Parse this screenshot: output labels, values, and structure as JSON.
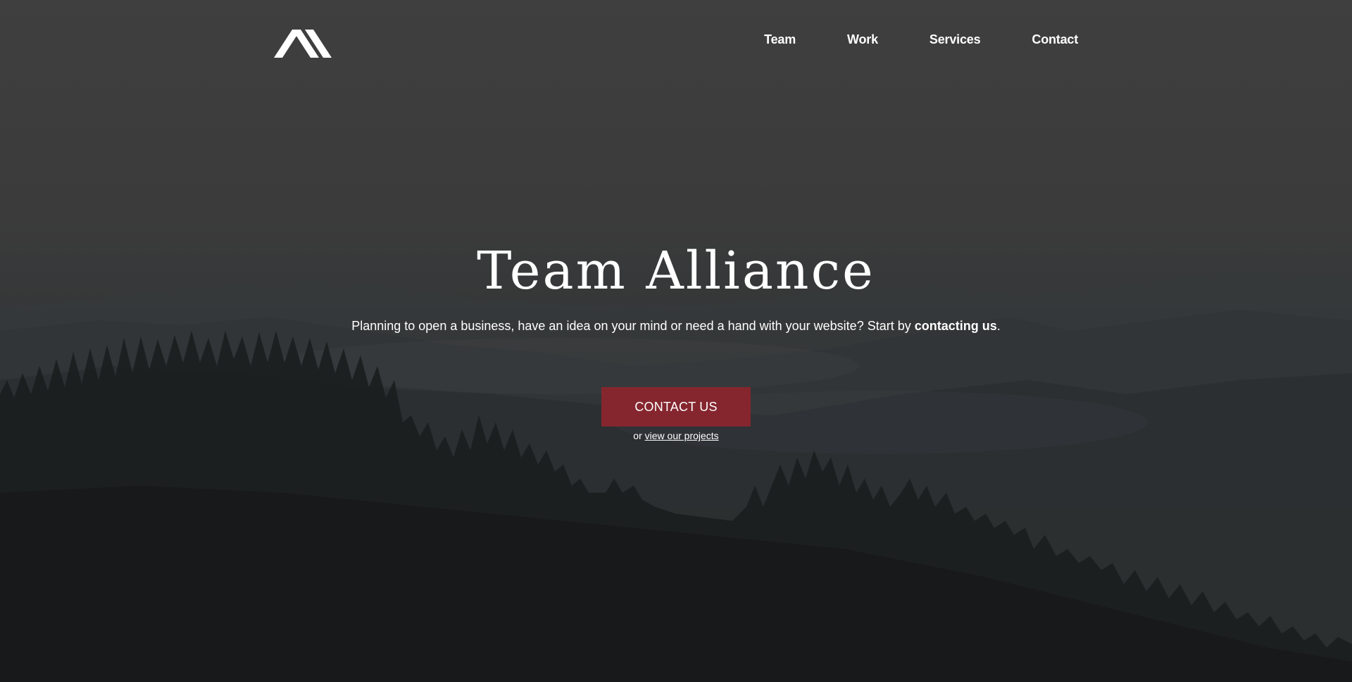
{
  "brand": {
    "logo_icon": "mountain-peaks-logo-icon"
  },
  "nav": {
    "items": [
      {
        "label": "Team"
      },
      {
        "label": "Work"
      },
      {
        "label": "Services"
      },
      {
        "label": "Contact"
      }
    ]
  },
  "hero": {
    "title": "Team Alliance",
    "subtitle_prefix": "Planning to open a business, have an idea on your mind or need a hand with your website? Start by ",
    "subtitle_bold": "contacting us",
    "subtitle_suffix": ".",
    "cta_label": "CONTACT US",
    "secondary_prefix": "or ",
    "secondary_link": "view our projects"
  },
  "colors": {
    "cta_background": "#85262f",
    "text": "#ffffff",
    "overlay": "#3f3f3f"
  }
}
